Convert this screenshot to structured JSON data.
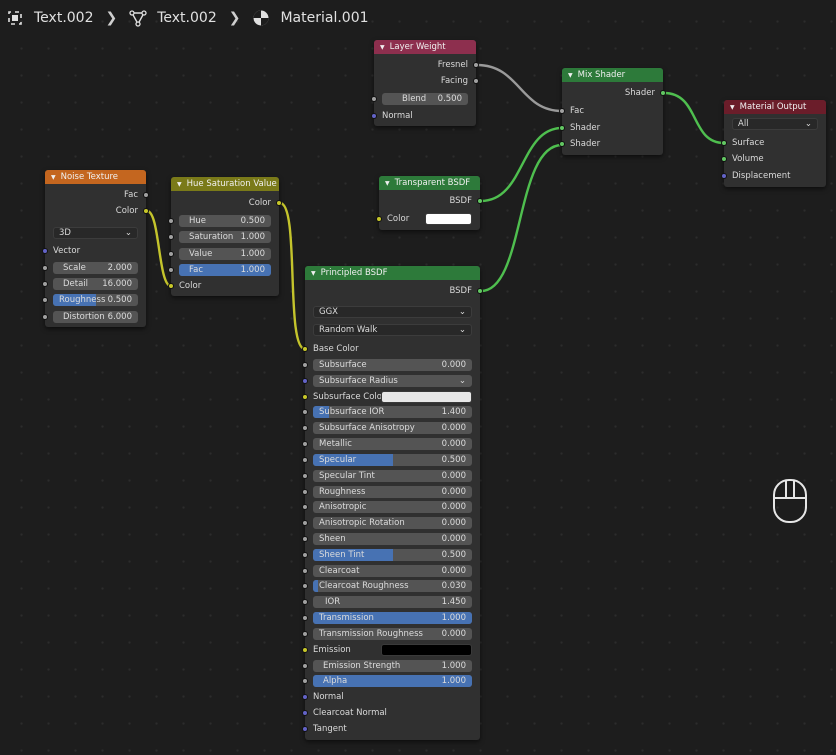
{
  "breadcrumb": {
    "object": "Text.002",
    "data": "Text.002",
    "material": "Material.001"
  },
  "colors": {
    "header_texture": "#c4661f",
    "header_color": "#7a7a19",
    "header_input": "#8d2f4e",
    "header_shader": "#2d7a3a",
    "header_output": "#6b1d2a",
    "socket_color": "#c7c729",
    "socket_float": "#a1a1a1",
    "socket_shader": "#63c763",
    "socket_vector": "#6363c7",
    "field_active": "#4772b3"
  },
  "noise_texture": {
    "title": "Noise Texture",
    "out_fac": "Fac",
    "out_color": "Color",
    "dimension": "3D",
    "vector": "Vector",
    "fields": [
      {
        "label": "Scale",
        "value": "2.000"
      },
      {
        "label": "Detail",
        "value": "16.000"
      },
      {
        "label": "Roughness",
        "value": "0.500",
        "fill": 0.5
      },
      {
        "label": "Distortion",
        "value": "6.000"
      }
    ]
  },
  "hue_sat": {
    "title": "Hue Saturation Value",
    "out_color": "Color",
    "fields": [
      {
        "label": "Hue",
        "value": "0.500"
      },
      {
        "label": "Saturation",
        "value": "1.000"
      },
      {
        "label": "Value",
        "value": "1.000"
      },
      {
        "label": "Fac",
        "value": "1.000",
        "fill": 1.0
      }
    ],
    "in_color": "Color"
  },
  "layer_weight": {
    "title": "Layer Weight",
    "out_fresnel": "Fresnel",
    "out_facing": "Facing",
    "blend_label": "Blend",
    "blend_value": "0.500",
    "normal": "Normal"
  },
  "transparent": {
    "title": "Transparent BSDF",
    "out_bsdf": "BSDF",
    "color": "Color",
    "color_value": "#ffffff"
  },
  "mix_shader": {
    "title": "Mix Shader",
    "out_shader": "Shader",
    "fac": "Fac",
    "shader1": "Shader",
    "shader2": "Shader"
  },
  "material_output": {
    "title": "Material Output",
    "target": "All",
    "surface": "Surface",
    "volume": "Volume",
    "displacement": "Displacement"
  },
  "principled": {
    "title": "Principled BSDF",
    "out_bsdf": "BSDF",
    "distribution": "GGX",
    "subsurface_method": "Random Walk",
    "base_color": "Base Color",
    "subsurface": {
      "label": "Subsurface",
      "value": "0.000"
    },
    "subsurface_radius": "Subsurface Radius",
    "subsurface_color": "Subsurface Colo",
    "subsurface_color_value": "#e8e8e8",
    "fields": [
      {
        "label": "Subsurface IOR",
        "value": "1.400",
        "fill": 0.1
      },
      {
        "label": "Subsurface Anisotropy",
        "value": "0.000"
      },
      {
        "label": "Metallic",
        "value": "0.000"
      },
      {
        "label": "Specular",
        "value": "0.500",
        "fill": 0.5
      },
      {
        "label": "Specular Tint",
        "value": "0.000"
      },
      {
        "label": "Roughness",
        "value": "0.000"
      },
      {
        "label": "Anisotropic",
        "value": "0.000"
      },
      {
        "label": "Anisotropic Rotation",
        "value": "0.000"
      },
      {
        "label": "Sheen",
        "value": "0.000"
      },
      {
        "label": "Sheen Tint",
        "value": "0.500",
        "fill": 0.5
      },
      {
        "label": "Clearcoat",
        "value": "0.000"
      },
      {
        "label": "Clearcoat Roughness",
        "value": "0.030",
        "fill": 0.03
      },
      {
        "label": "IOR",
        "value": "1.450"
      },
      {
        "label": "Transmission",
        "value": "1.000",
        "fill": 1.0
      },
      {
        "label": "Transmission Roughness",
        "value": "0.000"
      }
    ],
    "emission": "Emission",
    "emission_value": "#000000",
    "emission_strength": {
      "label": "Emission Strength",
      "value": "1.000"
    },
    "alpha": {
      "label": "Alpha",
      "value": "1.000",
      "fill": 1.0
    },
    "normal": "Normal",
    "clearcoat_normal": "Clearcoat Normal",
    "tangent": "Tangent"
  }
}
